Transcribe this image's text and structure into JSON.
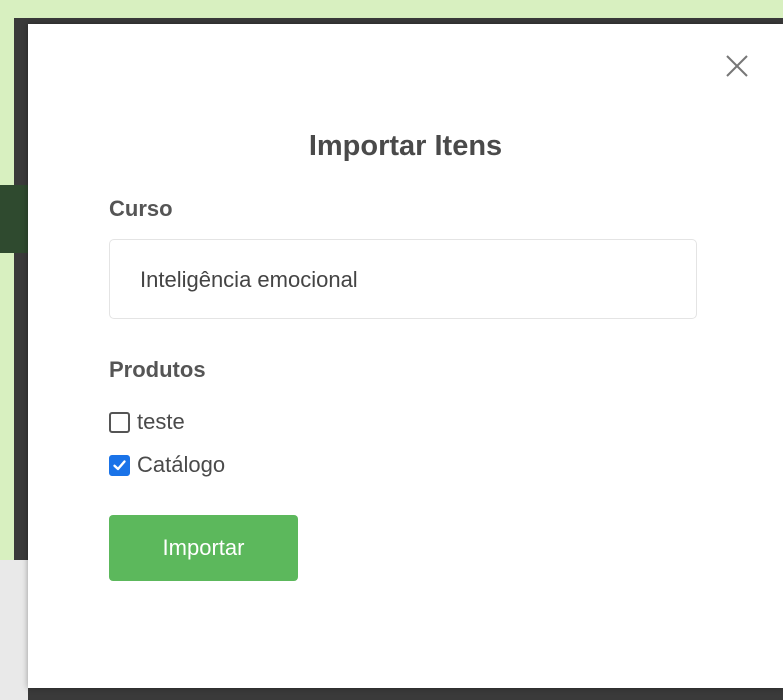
{
  "modal": {
    "title": "Importar Itens",
    "course": {
      "label": "Curso",
      "value": "Inteligência emocional"
    },
    "products": {
      "label": "Produtos",
      "items": [
        {
          "label": "teste",
          "checked": false
        },
        {
          "label": "Catálogo",
          "checked": true
        }
      ]
    },
    "submit_label": "Importar",
    "close_icon": "close-icon"
  },
  "colors": {
    "primary_button": "#5cb85c",
    "checkbox_checked": "#1a73e8",
    "title_text": "#4a4a4a"
  }
}
